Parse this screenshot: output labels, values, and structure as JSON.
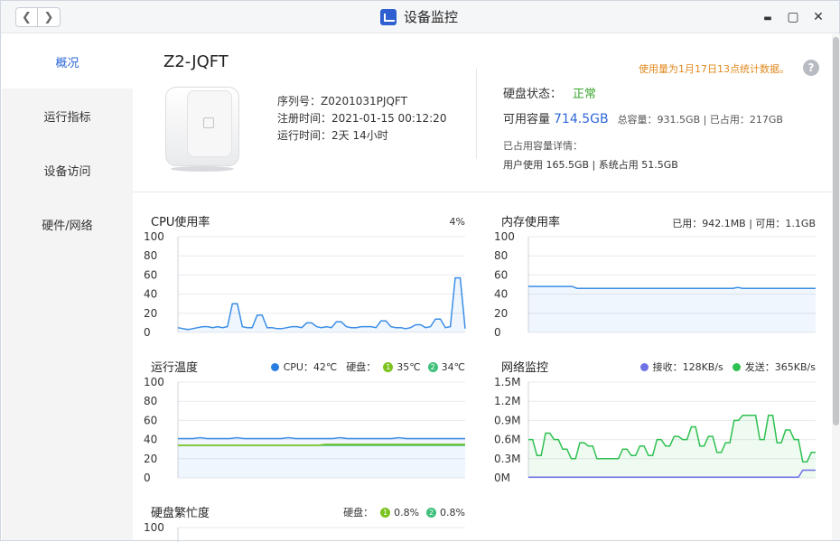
{
  "window": {
    "title": "设备监控",
    "back_glyph": "❮",
    "forward_glyph": "❯",
    "minimize_glyph": "▬",
    "maximize_glyph": "▢",
    "close_glyph": "✕"
  },
  "sidebar": {
    "items": [
      {
        "label": "概况",
        "active": true
      },
      {
        "label": "运行指标",
        "active": false
      },
      {
        "label": "设备访问",
        "active": false
      },
      {
        "label": "硬件/网络",
        "active": false
      }
    ]
  },
  "device": {
    "name": "Z2-JQFT",
    "serial": "序列号：Z0201031PJQFT",
    "registered": "注册时间：2021-01-15 00:12:20",
    "uptime": "运行时间：2天 14小时"
  },
  "storage": {
    "notice": "使用量为1月17日13点统计数据。",
    "help_glyph": "?",
    "status_label": "硬盘状态：",
    "status_value": "正常",
    "available_label": "可用容量",
    "available_value": "714.5GB",
    "total_text": "总容量：931.5GB | 已占用：217GB",
    "detail_title": "已占用容量详情：",
    "detail_text": "用户使用 165.5GB | 系统占用 51.5GB"
  },
  "cpu": {
    "title": "CPU使用率",
    "stat": "4%",
    "yticks": [
      "100",
      "80",
      "60",
      "40",
      "20",
      "0"
    ]
  },
  "memory": {
    "title": "内存使用率",
    "stat": "已用：942.1MB | 可用：1.1GB",
    "yticks": [
      "100",
      "80",
      "60",
      "40",
      "20",
      "0"
    ]
  },
  "temperature": {
    "title": "运行温度",
    "cpu_label": "CPU：42℃",
    "disk_label": "硬盘：",
    "disk1_num": "1",
    "disk1_val": "35℃",
    "disk2_num": "2",
    "disk2_val": "34℃",
    "yticks": [
      "100",
      "80",
      "60",
      "40",
      "20",
      "0"
    ]
  },
  "network": {
    "title": "网络监控",
    "recv_label": "接收：128KB/s",
    "send_label": "发送：365KB/s",
    "yticks": [
      "1.5M",
      "1.2M",
      "0.9M",
      "0.6M",
      "0.3M",
      "0M"
    ]
  },
  "disk_busy": {
    "title": "硬盘繁忙度",
    "disk_label": "硬盘：",
    "disk1_num": "1",
    "disk1_val": "0.8%",
    "disk2_num": "2",
    "disk2_val": "0.8%",
    "yticks": [
      "100"
    ]
  },
  "colors": {
    "accent": "#2d68d8",
    "cpu_line": "#3a8ee6",
    "disk_green": "#7cc21d",
    "disk2_green": "#3ec07a",
    "net_recv": "#6e72e8",
    "net_send": "#2ec050",
    "ok": "#3aa62c",
    "warning": "#e08a1e"
  },
  "chart_data": [
    {
      "type": "area",
      "title": "CPU使用率",
      "ylim": [
        0,
        100
      ],
      "series": [
        {
          "values": [
            5,
            4,
            3,
            4,
            5,
            6,
            6,
            5,
            6,
            5,
            6,
            30,
            30,
            6,
            5,
            5,
            18,
            18,
            5,
            5,
            4,
            4,
            5,
            6,
            6,
            5,
            10,
            10,
            6,
            5,
            6,
            5,
            11,
            11,
            6,
            5,
            5,
            6,
            6,
            6,
            5,
            12,
            12,
            6,
            5,
            5,
            4,
            5,
            8,
            8,
            5,
            6,
            14,
            14,
            5,
            6,
            57,
            57,
            4
          ]
        }
      ]
    },
    {
      "type": "area",
      "title": "内存使用率",
      "ylim": [
        0,
        100
      ],
      "series": [
        {
          "values": [
            48,
            48,
            48,
            48,
            48,
            48,
            48,
            48,
            48,
            48,
            46,
            46,
            46,
            46,
            46,
            46,
            46,
            46,
            46,
            46,
            46,
            46,
            46,
            46,
            46,
            46,
            46,
            46,
            46,
            46,
            46,
            46,
            46,
            46,
            46,
            46,
            46,
            46,
            46,
            46,
            46,
            46,
            46,
            47,
            46,
            46,
            46,
            46,
            46,
            46,
            46,
            46,
            46,
            46,
            46,
            46,
            46,
            46,
            46,
            46
          ]
        }
      ]
    },
    {
      "type": "line",
      "title": "运行温度",
      "ylim": [
        0,
        100
      ],
      "series": [
        {
          "name": "CPU：42℃",
          "values": [
            41,
            41,
            41,
            42,
            41,
            41,
            41,
            41,
            42,
            41,
            41,
            41,
            41,
            41,
            41,
            42,
            41,
            41,
            41,
            41,
            41,
            41,
            42,
            41,
            41,
            41,
            41,
            41,
            41,
            41,
            42,
            41,
            41,
            41,
            41,
            41,
            41,
            41,
            41,
            41
          ]
        },
        {
          "name": "1",
          "values": [
            34,
            34,
            34,
            34,
            34,
            34,
            34,
            34,
            34,
            34,
            34,
            34,
            34,
            34,
            34,
            34,
            34,
            34,
            34,
            34,
            35,
            35,
            35,
            35,
            35,
            35,
            35,
            35,
            35,
            35,
            35,
            35,
            35,
            35,
            35,
            35,
            35,
            35,
            35,
            35
          ]
        },
        {
          "name": "2",
          "values": [
            34,
            34,
            34,
            34,
            34,
            34,
            34,
            34,
            34,
            34,
            34,
            34,
            34,
            34,
            34,
            34,
            34,
            34,
            34,
            34,
            34,
            34,
            34,
            34,
            34,
            34,
            34,
            34,
            34,
            34,
            34,
            34,
            34,
            34,
            34,
            34,
            34,
            34,
            34,
            34
          ]
        }
      ]
    },
    {
      "type": "area",
      "title": "网络监控",
      "ylim": [
        0,
        1.5
      ],
      "series": [
        {
          "name": "接收：128KB/s",
          "values": [
            0.01,
            0.01,
            0.01,
            0.01,
            0.01,
            0.01,
            0.01,
            0.01,
            0.01,
            0.01,
            0.01,
            0.01,
            0.01,
            0.01,
            0.01,
            0.01,
            0.01,
            0.01,
            0.01,
            0.01,
            0.01,
            0.01,
            0.01,
            0.01,
            0.01,
            0.01,
            0.01,
            0.01,
            0.01,
            0.01,
            0.01,
            0.01,
            0.01,
            0.01,
            0.01,
            0.01,
            0.01,
            0.01,
            0.01,
            0.01,
            0.01,
            0.01,
            0.01,
            0.01,
            0.01,
            0.01,
            0.01,
            0.01,
            0.01,
            0.01,
            0.01,
            0.01,
            0.01,
            0.01,
            0.01,
            0.01,
            0.01,
            0.01,
            0.01,
            0.01,
            0.01,
            0.01,
            0.01,
            0.01,
            0.12,
            0.12,
            0.12,
            0.12
          ]
        },
        {
          "name": "发送：365KB/s",
          "values": [
            0.6,
            0.6,
            0.35,
            0.35,
            0.7,
            0.7,
            0.6,
            0.6,
            0.45,
            0.45,
            0.3,
            0.3,
            0.55,
            0.55,
            0.5,
            0.5,
            0.3,
            0.3,
            0.3,
            0.3,
            0.3,
            0.3,
            0.45,
            0.45,
            0.35,
            0.35,
            0.5,
            0.5,
            0.35,
            0.35,
            0.6,
            0.6,
            0.5,
            0.5,
            0.65,
            0.65,
            0.6,
            0.6,
            0.8,
            0.8,
            0.5,
            0.5,
            0.65,
            0.65,
            0.4,
            0.4,
            0.55,
            0.55,
            0.9,
            0.9,
            0.98,
            0.98,
            0.98,
            0.98,
            0.6,
            0.6,
            0.98,
            0.98,
            0.55,
            0.55,
            0.75,
            0.75,
            0.6,
            0.6,
            0.25,
            0.25,
            0.4,
            0.4
          ]
        }
      ]
    },
    {
      "type": "line",
      "title": "硬盘繁忙度",
      "ylim": [
        0,
        100
      ],
      "series": [
        {
          "name": "1",
          "values": []
        },
        {
          "name": "2",
          "values": []
        }
      ]
    }
  ]
}
